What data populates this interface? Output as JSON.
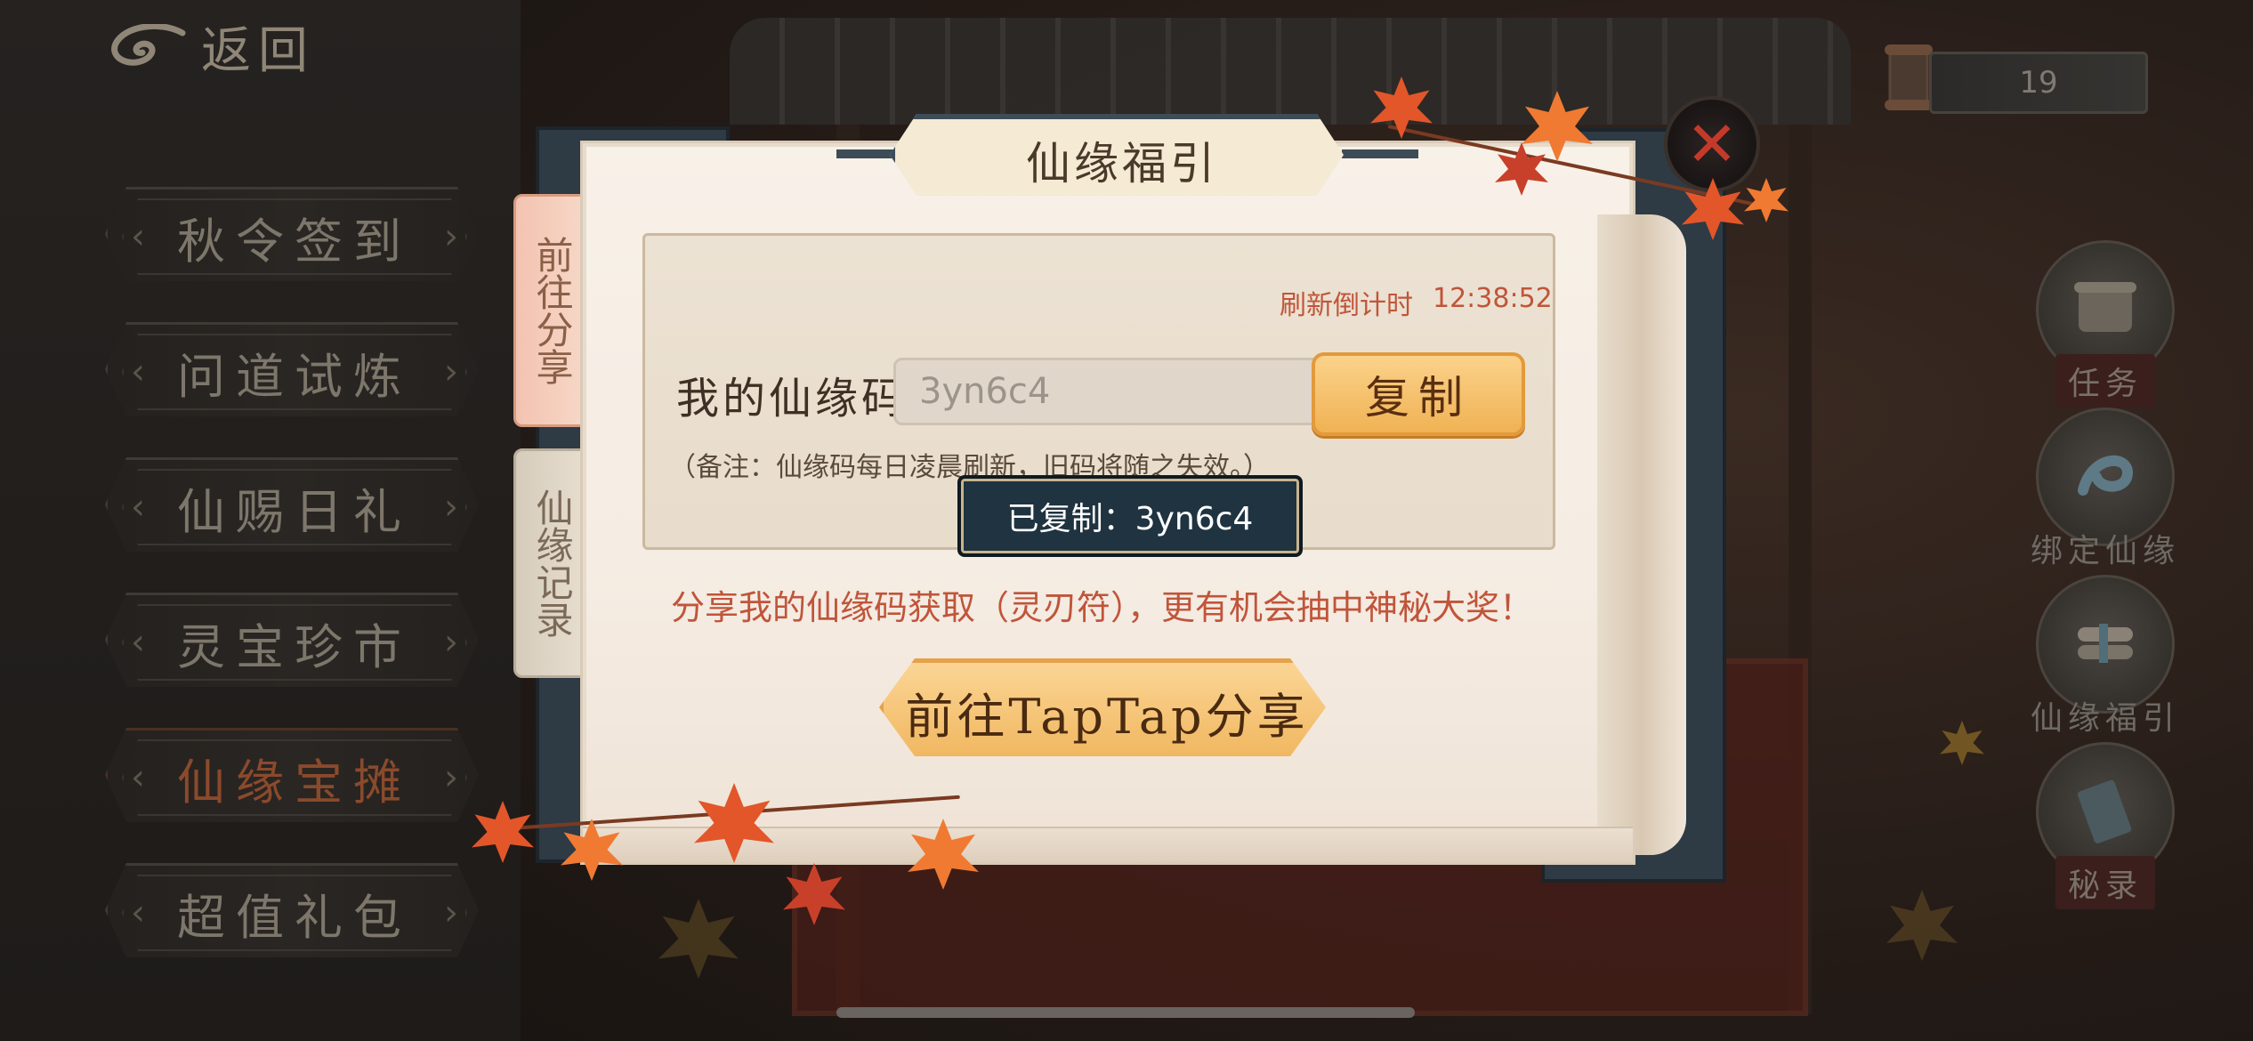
{
  "header": {
    "back_label": "返回"
  },
  "menu": {
    "items": [
      {
        "label": "秋令签到",
        "active": false
      },
      {
        "label": "问道试炼",
        "active": false
      },
      {
        "label": "仙赐日礼",
        "active": false
      },
      {
        "label": "灵宝珍市",
        "active": false
      },
      {
        "label": "仙缘宝摊",
        "active": true
      },
      {
        "label": "超值礼包",
        "active": false
      }
    ]
  },
  "top_counter": {
    "value": "19"
  },
  "sidebar": {
    "items": [
      {
        "label": "任务",
        "icon": "scroll-icon"
      },
      {
        "label": "绑定仙缘",
        "icon": "ribbon-icon"
      },
      {
        "label": "仙缘福引",
        "icon": "scroll-stack-icon"
      },
      {
        "label": "秘录",
        "icon": "book-icon"
      }
    ]
  },
  "modal": {
    "title": "仙缘福引",
    "tabs": {
      "share": "前往分享",
      "record": "仙缘记录"
    },
    "refresh_label": "刷新倒计时",
    "refresh_time": "12:38:52",
    "code_label": "我的仙缘码",
    "code_value": "3yn6c4",
    "copy_label": "复制",
    "note": "（备注：仙缘码每日凌晨刷新，旧码将随之失效。）",
    "toast": "已复制：3yn6c4",
    "promo": "分享我的仙缘码获取（灵刃符），更有机会抽中神秘大奖！",
    "share_button": "前往TapTap分享",
    "close_icon": "close-icon"
  },
  "colors": {
    "accent_red": "#c0553a",
    "button_gold": "#f0b254",
    "banner_border": "#3d4d58"
  }
}
